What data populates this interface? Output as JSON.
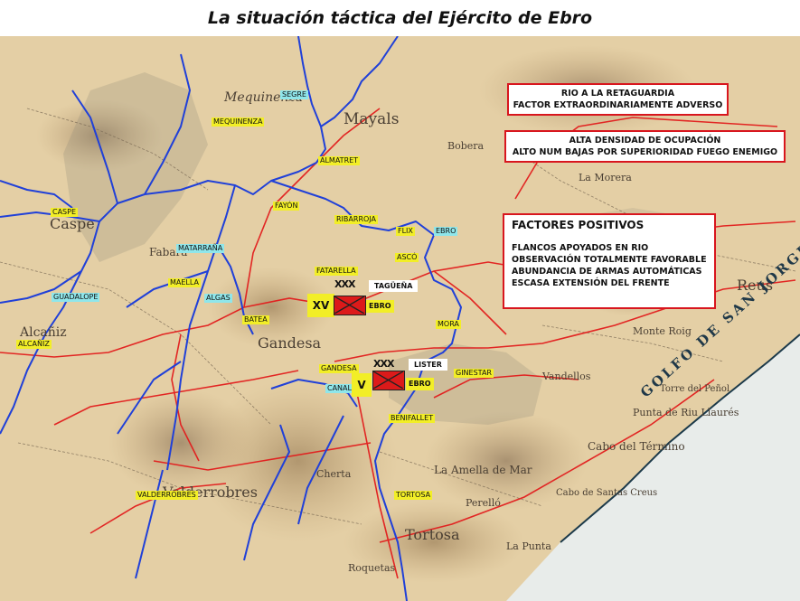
{
  "title": "La situación táctica  del Ejército de Ebro",
  "colors": {
    "river": "#2040d8",
    "roads": "#e21d1d",
    "label_yellow": "#f2ee27",
    "label_cyan": "#8fe6ea",
    "box_border": "#d8161e"
  },
  "boxes": {
    "rio": {
      "line1": "RIO A LA RETAGUARDIA",
      "line2": "FACTOR EXTRAORDINARIAMENTE ADVERSO"
    },
    "densidad": {
      "line1": "ALTA DENSIDAD DE OCUPACIÓN",
      "line2": "ALTO NUM BAJAS POR SUPERIORIDAD FUEGO ENEMIGO"
    },
    "positivos": {
      "heading": "FACTORES POSITIVOS",
      "items": [
        "FLANCOS APOYADOS EN RIO",
        "OBSERVACIÓN TOTALMENTE FAVORABLE",
        "ABUNDANCIA DE ARMAS AUTOMÁTICAS",
        "ESCASA EXTENSIÓN DEL FRENTE"
      ]
    }
  },
  "units": {
    "xv": {
      "number": "XV",
      "army": "EBRO",
      "commander": "TAGÜEÑA",
      "echelon": "XXX"
    },
    "v": {
      "number": "V",
      "army": "EBRO",
      "commander": "LISTER",
      "echelon": "XXX"
    }
  },
  "places": {
    "segre": "SEGRE",
    "mequinenza": "MEQUINENZA",
    "almatret": "ALMATRET",
    "caspe": "CASPE",
    "fayon": "FAYÓN",
    "ribarroja": "RIBARROJA",
    "flix": "FLIX",
    "ebro": "EBRO",
    "matarrana": "MATARRAÑA",
    "asco": "ASCÓ",
    "fatarella": "FATARELLA",
    "maella": "MAELLA",
    "algas": "ALGAS",
    "guadalope": "GUADALOPE",
    "batea": "BATEA",
    "mora": "MORA",
    "alcaniz": "ALCAÑIZ",
    "gandesa": "GANDESA",
    "canal": "CANAL",
    "ginestar": "GINESTAR",
    "benifallet": "BENIFALLET",
    "valderrobres": "VALDERROBRES",
    "tortosa": "TORTOSA"
  },
  "map_text": {
    "mequinenza": "Mequinenza",
    "mayals": "Mayals",
    "caspe": "Caspe",
    "fabara": "Fabara",
    "gandesa": "Gandesa",
    "valderrobres": "Valderrobres",
    "tortosa": "Tortosa",
    "reus": "Reus",
    "golfo": "GOLFO DE SAN JORGE",
    "vandellos": "Vandellos",
    "cabo": "Cabo del Término",
    "canals": "Cabo de Santas Creus",
    "amella": "La Amella de Mar",
    "alcaniz": "Alcañiz",
    "perello": "Perelló",
    "montroig": "Monte Roig",
    "cherta": "Cherta",
    "roquetas": "Roquetas",
    "lapunta": "La Punta",
    "torrefenol": "Torre del Peñol",
    "puntariu": "Punta de Riu Llaurés",
    "boquela": "Bobera",
    "lamorera": "La Morera"
  }
}
